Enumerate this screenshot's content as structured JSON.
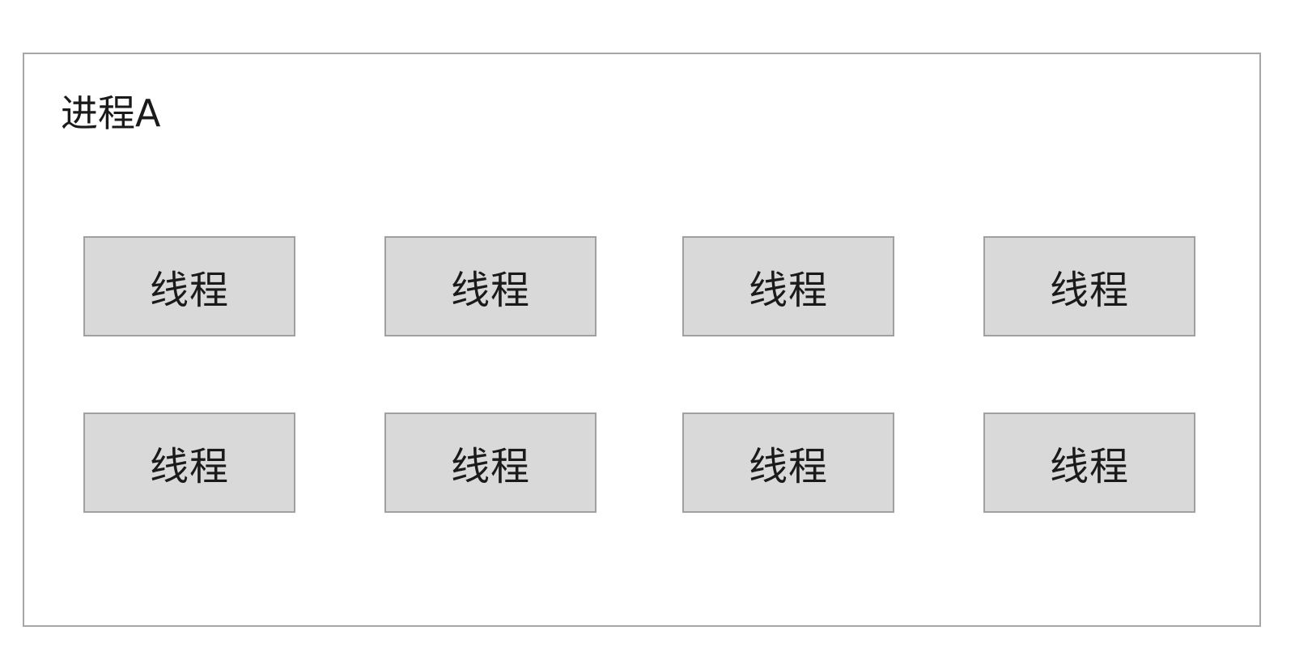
{
  "process": {
    "title": "进程A"
  },
  "threads": [
    {
      "label": "线程"
    },
    {
      "label": "线程"
    },
    {
      "label": "线程"
    },
    {
      "label": "线程"
    },
    {
      "label": "线程"
    },
    {
      "label": "线程"
    },
    {
      "label": "线程"
    },
    {
      "label": "线程"
    }
  ],
  "colors": {
    "thread_fill": "#d9d9d9",
    "thread_border": "#a0a0a0",
    "process_border": "#a6a6a6"
  }
}
